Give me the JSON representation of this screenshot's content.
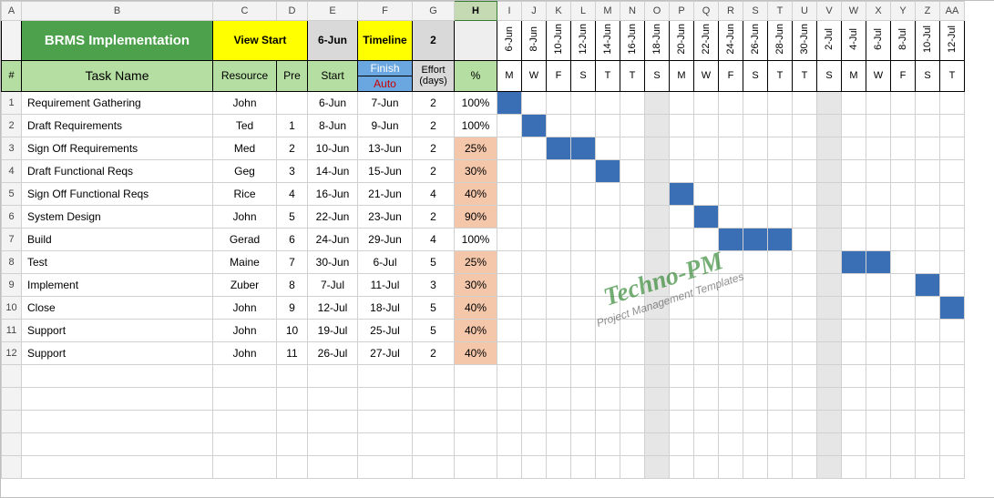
{
  "colLetters": [
    "A",
    "B",
    "C",
    "D",
    "E",
    "F",
    "G",
    "H",
    "I",
    "J",
    "K",
    "L",
    "M",
    "N",
    "O",
    "P",
    "Q",
    "R",
    "S",
    "T",
    "U",
    "V",
    "W",
    "X",
    "Y",
    "Z",
    "AA"
  ],
  "header": {
    "title": "BRMS Implementation",
    "viewStart": "View Start",
    "sixJun": "6-Jun",
    "timeline": "Timeline",
    "timelineVal": "2",
    "numLbl": "#",
    "taskNameLbl": "Task Name",
    "resourceLbl": "Resource",
    "preLbl": "Pre",
    "startLbl": "Start",
    "finishLbl": "Finish",
    "autoLbl": "Auto",
    "effortLbl1": "Effort",
    "effortLbl2": "(days)",
    "pctLbl": "%"
  },
  "calendar": {
    "dates": [
      "6-Jun",
      "8-Jun",
      "10-Jun",
      "12-Jun",
      "14-Jun",
      "16-Jun",
      "18-Jun",
      "20-Jun",
      "22-Jun",
      "24-Jun",
      "26-Jun",
      "28-Jun",
      "30-Jun",
      "2-Jul",
      "4-Jul",
      "6-Jul",
      "8-Jul",
      "10-Jul",
      "12-Jul"
    ],
    "days": [
      "M",
      "W",
      "F",
      "S",
      "T",
      "T",
      "S",
      "M",
      "W",
      "F",
      "S",
      "T",
      "T",
      "S",
      "M",
      "W",
      "F",
      "S",
      "T"
    ],
    "weekendIdx": [
      6,
      13
    ]
  },
  "rows": [
    {
      "n": "1",
      "task": "Requirement Gathering",
      "res": "John",
      "pre": "",
      "start": "6-Jun",
      "finish": "7-Jun",
      "effort": "2",
      "pct": "100%",
      "pctPeach": false,
      "bar": [
        0
      ]
    },
    {
      "n": "2",
      "task": "Draft  Requirements",
      "res": "Ted",
      "pre": "1",
      "start": "8-Jun",
      "finish": "9-Jun",
      "effort": "2",
      "pct": "100%",
      "pctPeach": false,
      "bar": [
        1
      ]
    },
    {
      "n": "3",
      "task": "Sign Off  Requirements",
      "res": "Med",
      "pre": "2",
      "start": "10-Jun",
      "finish": "13-Jun",
      "effort": "2",
      "pct": "25%",
      "pctPeach": true,
      "bar": [
        2,
        3
      ]
    },
    {
      "n": "4",
      "task": "Draft Functional Reqs",
      "res": "Geg",
      "pre": "3",
      "start": "14-Jun",
      "finish": "15-Jun",
      "effort": "2",
      "pct": "30%",
      "pctPeach": true,
      "bar": [
        4
      ]
    },
    {
      "n": "5",
      "task": "Sign Off Functional Reqs",
      "res": "Rice",
      "pre": "4",
      "start": "16-Jun",
      "finish": "21-Jun",
      "effort": "4",
      "pct": "40%",
      "pctPeach": true,
      "bar": [
        7
      ]
    },
    {
      "n": "6",
      "task": "System Design",
      "res": "John",
      "pre": "5",
      "start": "22-Jun",
      "finish": "23-Jun",
      "effort": "2",
      "pct": "90%",
      "pctPeach": true,
      "bar": [
        8
      ]
    },
    {
      "n": "7",
      "task": "Build",
      "res": "Gerad",
      "pre": "6",
      "start": "24-Jun",
      "finish": "29-Jun",
      "effort": "4",
      "pct": "100%",
      "pctPeach": false,
      "bar": [
        9,
        10,
        11
      ]
    },
    {
      "n": "8",
      "task": "Test",
      "res": "Maine",
      "pre": "7",
      "start": "30-Jun",
      "finish": "6-Jul",
      "effort": "5",
      "pct": "25%",
      "pctPeach": true,
      "bar": [
        14,
        15
      ]
    },
    {
      "n": "9",
      "task": "Implement",
      "res": "Zuber",
      "pre": "8",
      "start": "7-Jul",
      "finish": "11-Jul",
      "effort": "3",
      "pct": "30%",
      "pctPeach": true,
      "bar": [
        17
      ]
    },
    {
      "n": "10",
      "task": "Close",
      "res": "John",
      "pre": "9",
      "start": "12-Jul",
      "finish": "18-Jul",
      "effort": "5",
      "pct": "40%",
      "pctPeach": true,
      "bar": [
        18
      ]
    },
    {
      "n": "11",
      "task": "Support",
      "res": "John",
      "pre": "10",
      "start": "19-Jul",
      "finish": "25-Jul",
      "effort": "5",
      "pct": "40%",
      "pctPeach": true,
      "bar": []
    },
    {
      "n": "12",
      "task": "Support",
      "res": "John",
      "pre": "11",
      "start": "26-Jul",
      "finish": "27-Jul",
      "effort": "2",
      "pct": "40%",
      "pctPeach": true,
      "bar": []
    }
  ],
  "blankRows": 5,
  "watermark": {
    "t1": "Techno-PM",
    "t2": "Project Management Templates"
  }
}
